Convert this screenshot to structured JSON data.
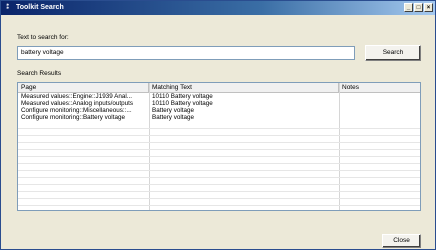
{
  "window": {
    "title": "Toolkit Search",
    "controls": {
      "minimize": "_",
      "maximize": "□",
      "close": "×"
    }
  },
  "search": {
    "label": "Text to search for:",
    "value": "battery voltage",
    "button": "Search"
  },
  "results": {
    "label": "Search Results",
    "columns": [
      "Page",
      "Matching Text",
      "Notes"
    ],
    "rows": [
      {
        "page": "Measured values::Engine::J1939 Anal...",
        "match": "10110 Battery voltage",
        "notes": ""
      },
      {
        "page": "Measured values::Analog inputs/outputs",
        "match": "10110 Battery voltage",
        "notes": ""
      },
      {
        "page": "Configure monitoring::Miscellaneous::...",
        "match": "Battery voltage",
        "notes": ""
      },
      {
        "page": "Configure monitoring::Battery voltage",
        "match": "Battery voltage",
        "notes": ""
      }
    ]
  },
  "footer": {
    "close": "Close"
  }
}
